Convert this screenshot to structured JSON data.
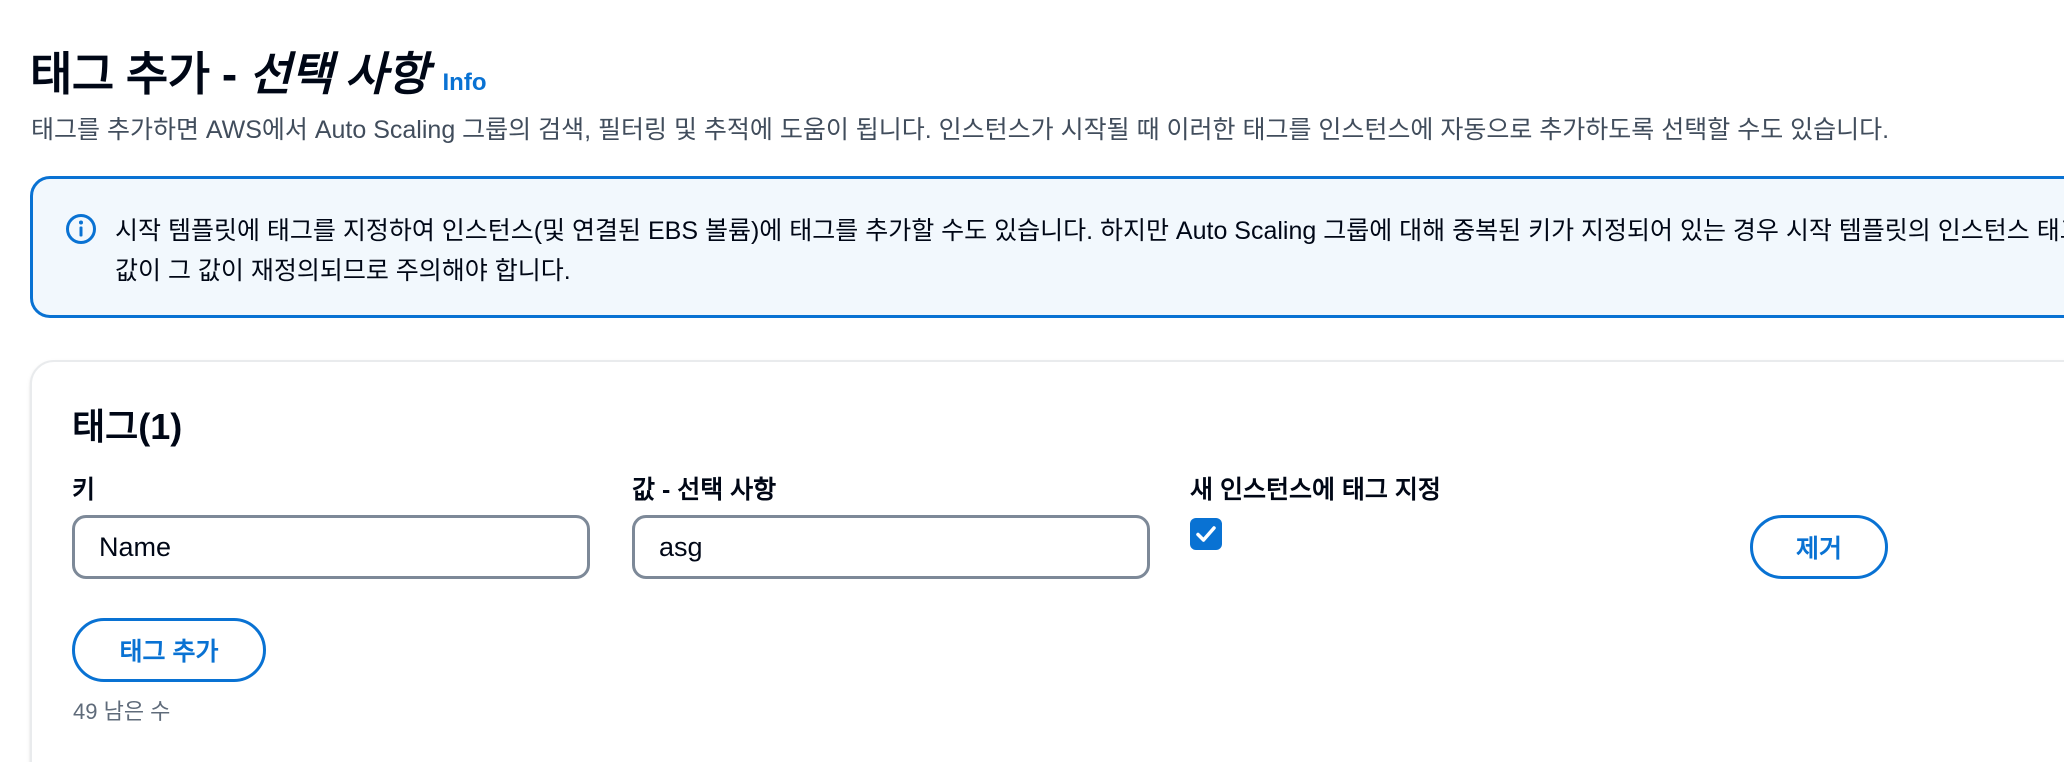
{
  "header": {
    "title_main": "태그 추가 - ",
    "title_optional": "선택 사항",
    "info_label": "Info"
  },
  "description": "태그를 추가하면 AWS에서 Auto Scaling 그룹의 검색, 필터링 및 추적에 도움이 됩니다. 인스턴스가 시작될 때 이러한 태그를 인스턴스에 자동으로 추가하도록 선택할 수도 있습니다.",
  "alert": {
    "icon": "info-circle-icon",
    "text": "시작 템플릿에 태그를 지정하여 인스턴스(및 연결된 EBS 볼륨)에 태그를 추가할 수도 있습니다. 하지만 Auto Scaling 그룹에 대해 중복된 키가 지정되어 있는 경우 시작 템플릿의 인스턴스 태그 값이 그 값이 재정의되므로 주의해야 합니다."
  },
  "tags": {
    "title": "태그(1)",
    "key_label": "키",
    "value_label": "값 - 선택 사항",
    "propagate_label": "새 인스턴스에 태그 지정",
    "rows": [
      {
        "key": "Name",
        "value": "asg",
        "propagate": true,
        "remove_label": "제거"
      }
    ],
    "add_button_label": "태그 추가",
    "remaining_text": "49 남은 수"
  },
  "colors": {
    "accent": "#0972d3",
    "alert_background": "#f2f8fd",
    "input_border": "#7d8998"
  }
}
